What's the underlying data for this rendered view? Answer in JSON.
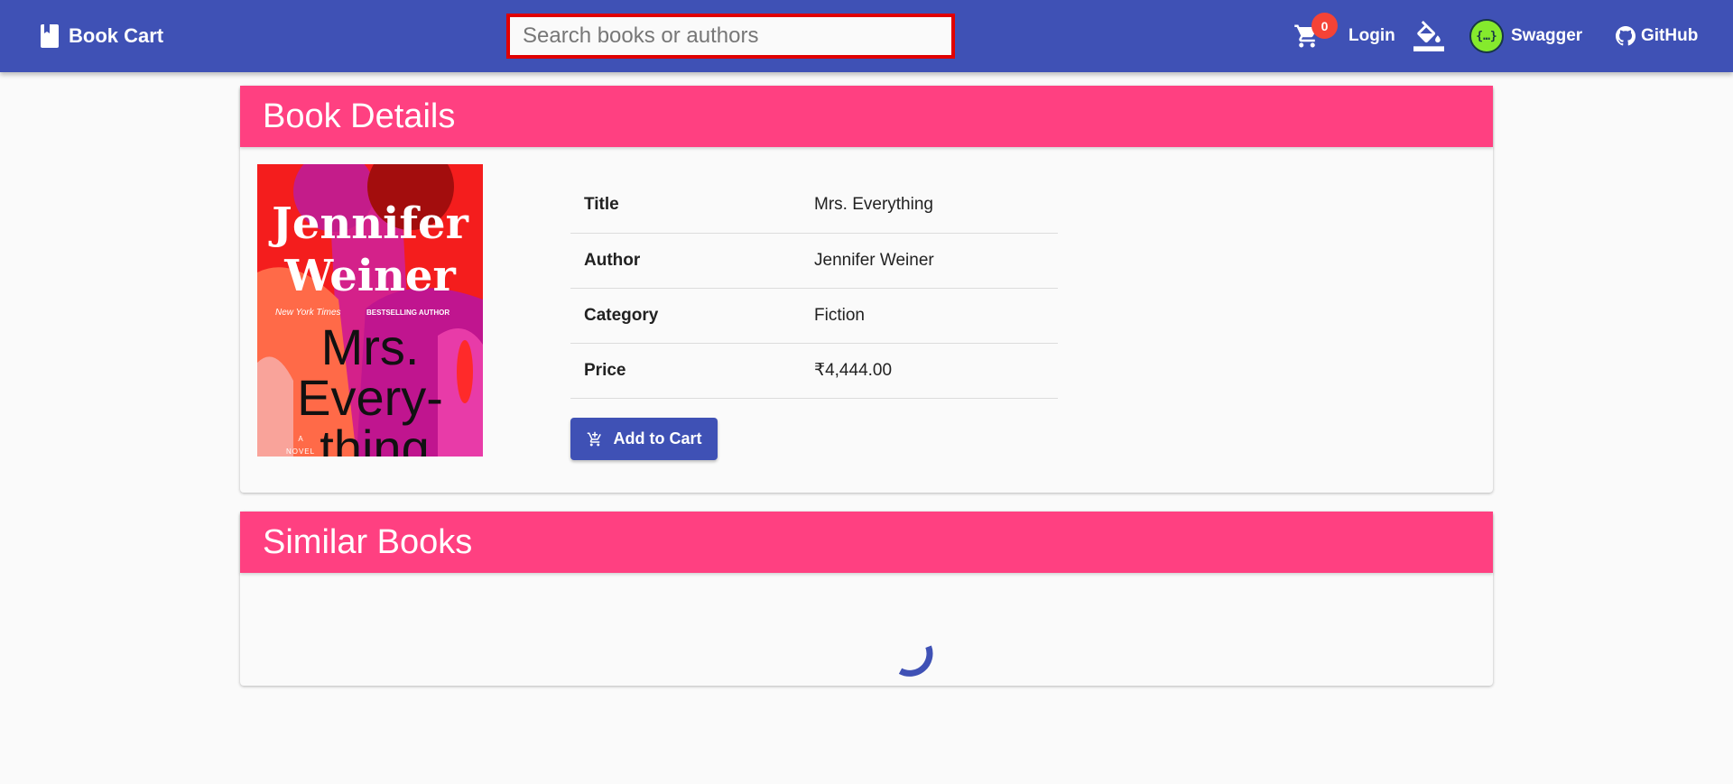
{
  "header": {
    "brand": "Book Cart",
    "search_placeholder": "Search books or authors",
    "cart_count": "0",
    "login": "Login",
    "swagger": "Swagger",
    "github": "GitHub"
  },
  "details": {
    "heading": "Book Details",
    "cover": {
      "author_line1": "Jennifer",
      "author_line2": "Weiner",
      "tagline_italic": "New York Times",
      "tagline_rest": "BESTSELLING AUTHOR",
      "title_line1": "Mrs.",
      "title_line2": "Every-",
      "title_line3": "thing",
      "novel_a": "A",
      "novel": "NOVEL"
    },
    "rows": [
      {
        "label": "Title",
        "value": "Mrs. Everything"
      },
      {
        "label": "Author",
        "value": "Jennifer Weiner"
      },
      {
        "label": "Category",
        "value": "Fiction"
      },
      {
        "label": "Price",
        "value": "₹4,444.00"
      }
    ],
    "add_to_cart": "Add to Cart"
  },
  "similar": {
    "heading": "Similar Books"
  },
  "colors": {
    "primary": "#3f51b5",
    "accent": "#ff4081",
    "badge": "#f44336"
  },
  "icons": [
    "book-icon",
    "cart-icon",
    "format-color-fill-icon",
    "swagger-logo",
    "github-icon",
    "add-shopping-cart-icon"
  ]
}
